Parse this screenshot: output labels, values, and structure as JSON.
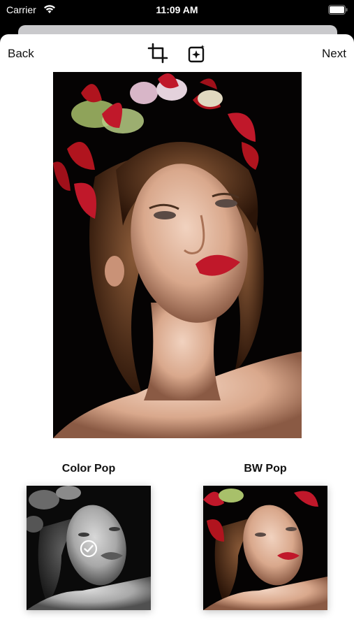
{
  "status_bar": {
    "carrier": "Carrier",
    "time": "11:09 AM"
  },
  "nav": {
    "back_label": "Back",
    "next_label": "Next",
    "crop_icon": "crop-icon",
    "magic_icon": "magic-enhance-icon"
  },
  "photo": {
    "subject": "portrait"
  },
  "filters": [
    {
      "label": "Color Pop",
      "selected": true,
      "style": "grayscale"
    },
    {
      "label": "BW Pop",
      "selected": false,
      "style": "color"
    }
  ],
  "colors": {
    "background": "#000000",
    "sheet": "#ffffff",
    "text": "#111111",
    "accent_red": "#c0182a"
  }
}
